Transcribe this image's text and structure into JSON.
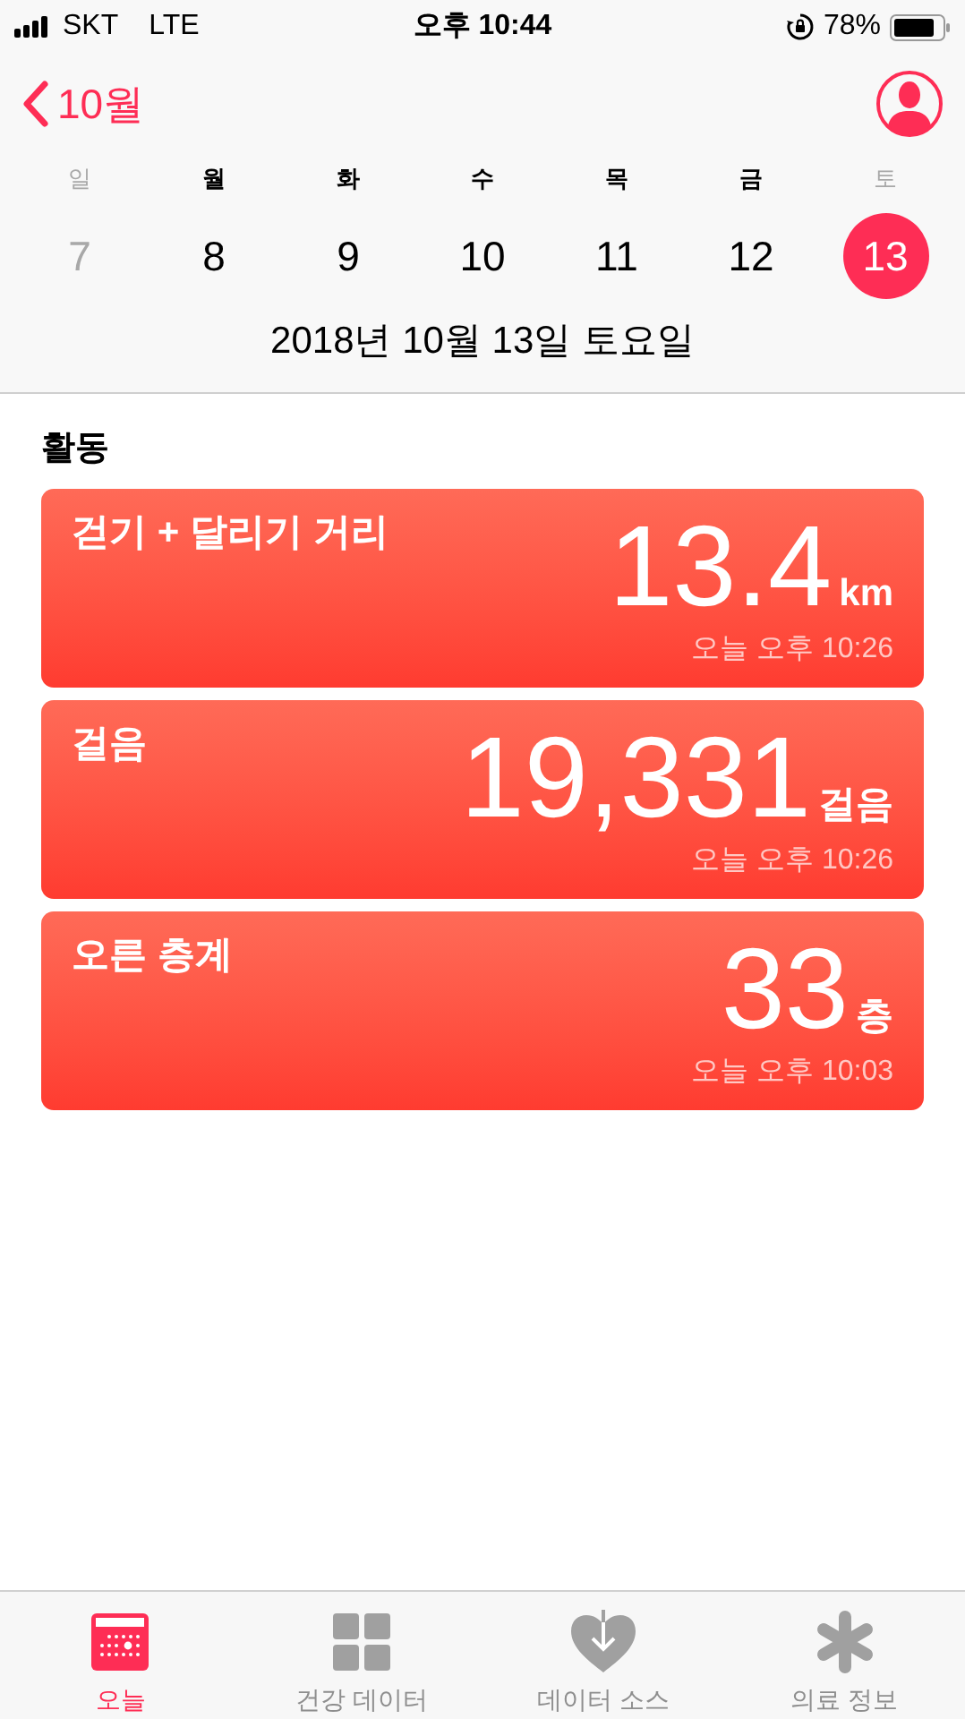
{
  "status_bar": {
    "carrier": "SKT",
    "network": "LTE",
    "time": "오후 10:44",
    "battery": "78%"
  },
  "nav": {
    "back": "10월"
  },
  "week": [
    {
      "weekday": "일",
      "day": "7",
      "weekend": true,
      "selected": false
    },
    {
      "weekday": "월",
      "day": "8",
      "weekend": false,
      "selected": false
    },
    {
      "weekday": "화",
      "day": "9",
      "weekend": false,
      "selected": false
    },
    {
      "weekday": "수",
      "day": "10",
      "weekend": false,
      "selected": false
    },
    {
      "weekday": "목",
      "day": "11",
      "weekend": false,
      "selected": false
    },
    {
      "weekday": "금",
      "day": "12",
      "weekend": false,
      "selected": false
    },
    {
      "weekday": "토",
      "day": "13",
      "weekend": true,
      "selected": true
    }
  ],
  "date": "2018년 10월 13일 토요일",
  "section": "활동",
  "cards": [
    {
      "title": "걷기 + 달리기 거리",
      "value": "13.4",
      "unit": "km",
      "time": "오늘 오후 10:26"
    },
    {
      "title": "걸음",
      "value": "19,331",
      "unit": "걸음",
      "time": "오늘 오후 10:26"
    },
    {
      "title": "오른 층계",
      "value": "33",
      "unit": "층",
      "time": "오늘 오후 10:03"
    }
  ],
  "tabs": [
    {
      "label": "오늘",
      "kind": "calendar",
      "selected": true
    },
    {
      "label": "건강 데이터",
      "kind": "grid",
      "selected": false
    },
    {
      "label": "데이터 소스",
      "kind": "heart",
      "selected": false
    },
    {
      "label": "의료 정보",
      "kind": "asterisk",
      "selected": false
    }
  ]
}
